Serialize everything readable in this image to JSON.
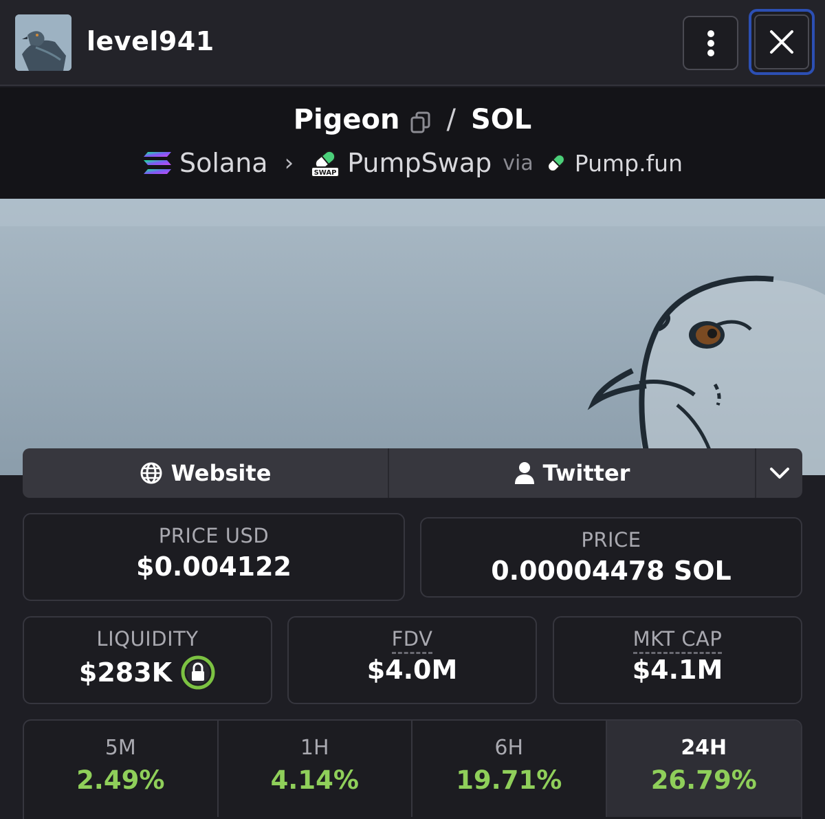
{
  "header": {
    "username": "level941",
    "avatar_icon": "pigeon-avatar",
    "menu_icon": "vertical-dots-icon",
    "close_icon": "close-x-icon"
  },
  "pair": {
    "base": "Pigeon",
    "separator": "/",
    "quote": "SOL",
    "chain": "Solana",
    "dex": "PumpSwap",
    "via_label": "via",
    "launchpad": "Pump.fun"
  },
  "links": {
    "website": "Website",
    "twitter": "Twitter"
  },
  "stats": {
    "price_usd_label": "PRICE USD",
    "price_usd": "$0.004122",
    "price_label": "PRICE",
    "price_sol": "0.00004478 SOL",
    "liquidity_label": "LIQUIDITY",
    "liquidity": "$283K",
    "fdv_label": "FDV",
    "fdv": "$4.0M",
    "mktcap_label": "MKT CAP",
    "mktcap": "$4.1M"
  },
  "periods": [
    {
      "label": "5M",
      "change": "2.49%"
    },
    {
      "label": "1H",
      "change": "4.14%"
    },
    {
      "label": "6H",
      "change": "19.71%"
    },
    {
      "label": "24H",
      "change": "26.79%"
    }
  ],
  "colors": {
    "accent_green": "#8fcf5a",
    "focus_blue": "#2c4fb3",
    "lock_green": "#7cc242"
  }
}
